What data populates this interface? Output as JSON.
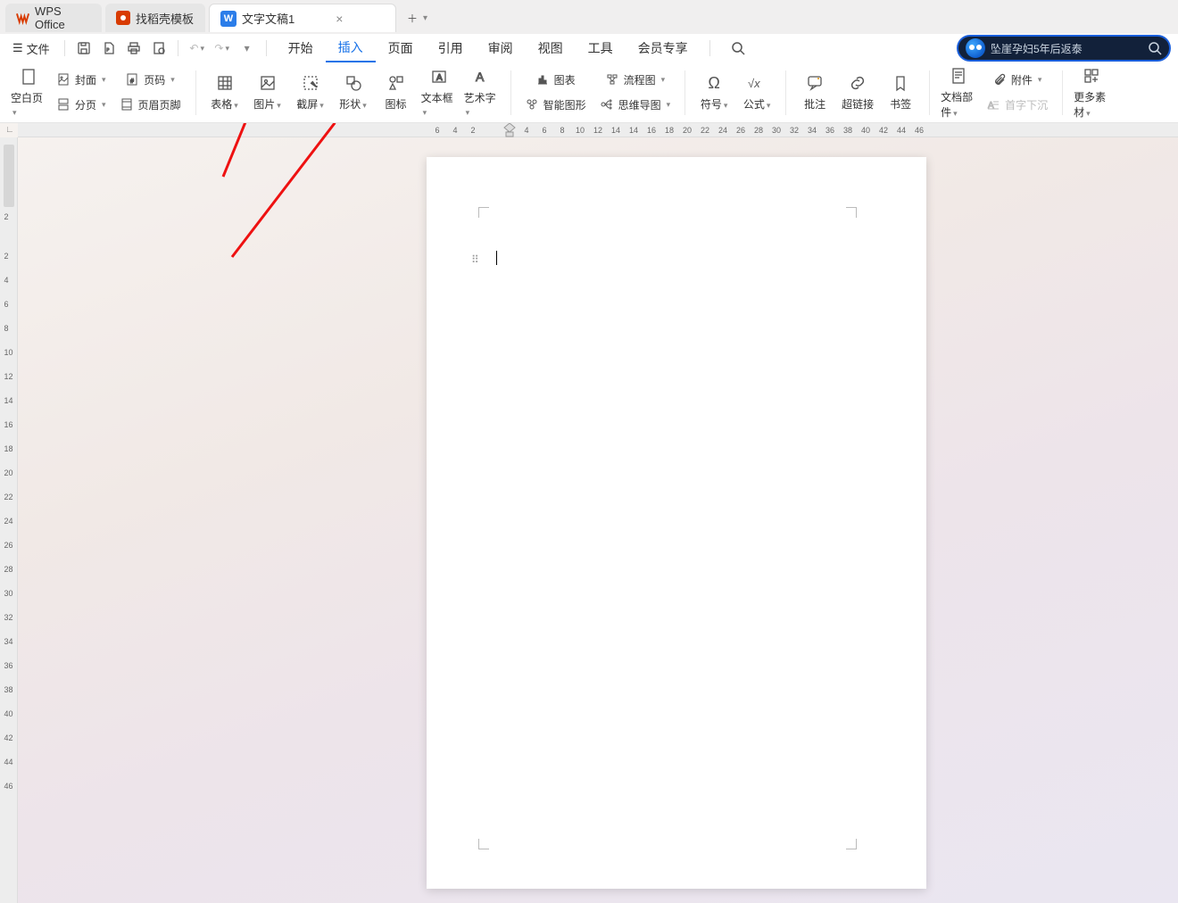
{
  "tabs": {
    "app": "WPS Office",
    "template": "找稻壳模板",
    "doc": "文字文稿1",
    "doc_badge": "W"
  },
  "file_menu": "文件",
  "menu": [
    "开始",
    "插入",
    "页面",
    "引用",
    "审阅",
    "视图",
    "工具",
    "会员专享"
  ],
  "active_menu_index": 1,
  "search_text": "坠崖孕妇5年后返泰",
  "ribbon": {
    "blank_page": "空白页",
    "cover": "封面",
    "page_number": "页码",
    "page_break": "分页",
    "header_footer": "页眉页脚",
    "table": "表格",
    "image": "图片",
    "screenshot": "截屏",
    "shape": "形状",
    "icon_lib": "图标",
    "text_box": "文本框",
    "wordart": "艺术字",
    "chart": "图表",
    "flowchart": "流程图",
    "smart_shape": "智能图形",
    "mindmap": "思维导图",
    "symbol": "符号",
    "formula": "公式",
    "comment": "批注",
    "hyperlink": "超链接",
    "bookmark": "书签",
    "doc_part": "文档部件",
    "attachment": "附件",
    "drop_cap": "首字下沉",
    "more_material": "更多素材"
  },
  "ruler_h": [
    "6",
    "4",
    "2",
    "",
    "2",
    "4",
    "6",
    "8",
    "10",
    "12",
    "14",
    "14",
    "16",
    "18",
    "20",
    "22",
    "24",
    "26",
    "28",
    "30",
    "32",
    "34",
    "36",
    "38",
    "40",
    "42",
    "44",
    "46"
  ],
  "ruler_v": [
    "2",
    "",
    "2",
    "4",
    "6",
    "8",
    "10",
    "12",
    "14",
    "16",
    "18",
    "20",
    "22",
    "24",
    "26",
    "28",
    "30",
    "32",
    "34",
    "36",
    "38",
    "40",
    "42",
    "44",
    "46"
  ]
}
